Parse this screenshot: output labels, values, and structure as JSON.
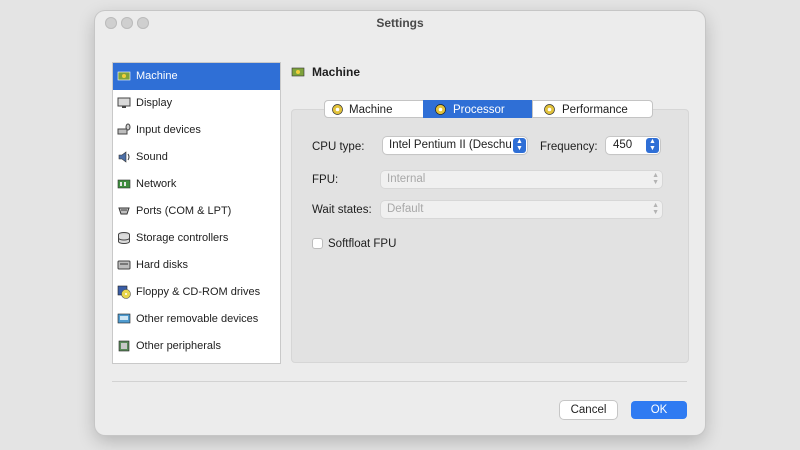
{
  "window": {
    "title": "Settings"
  },
  "sidebar": {
    "selected_index": 0,
    "items": [
      {
        "label": "Machine",
        "icon": "machine-icon"
      },
      {
        "label": "Display",
        "icon": "display-icon"
      },
      {
        "label": "Input devices",
        "icon": "input-devices-icon"
      },
      {
        "label": "Sound",
        "icon": "sound-icon"
      },
      {
        "label": "Network",
        "icon": "network-icon"
      },
      {
        "label": "Ports (COM & LPT)",
        "icon": "ports-icon"
      },
      {
        "label": "Storage controllers",
        "icon": "storage-controllers-icon"
      },
      {
        "label": "Hard disks",
        "icon": "hard-disk-icon"
      },
      {
        "label": "Floppy & CD-ROM drives",
        "icon": "floppy-cdrom-icon"
      },
      {
        "label": "Other removable devices",
        "icon": "removable-devices-icon"
      },
      {
        "label": "Other peripherals",
        "icon": "peripherals-icon"
      }
    ]
  },
  "section": {
    "title": "Machine",
    "icon": "machine-icon"
  },
  "tabs": {
    "selected_index": 1,
    "items": [
      {
        "label": "Machine",
        "icon": "machine-gear-icon"
      },
      {
        "label": "Processor",
        "icon": "processor-gear-icon"
      },
      {
        "label": "Performance",
        "icon": "performance-gear-icon"
      }
    ]
  },
  "processor": {
    "cpu_type_label": "CPU type:",
    "cpu_type_value": "Intel Pentium II (Deschutes)",
    "frequency_label": "Frequency:",
    "frequency_value": "450",
    "fpu_label": "FPU:",
    "fpu_value": "Internal",
    "fpu_enabled": false,
    "wait_states_label": "Wait states:",
    "wait_states_value": "Default",
    "wait_states_enabled": false,
    "softfloat_label": "Softfloat FPU",
    "softfloat_checked": false
  },
  "buttons": {
    "cancel": "Cancel",
    "ok": "OK"
  },
  "colors": {
    "accent": "#2f6fd6",
    "ok_button": "#2f7bf2"
  }
}
